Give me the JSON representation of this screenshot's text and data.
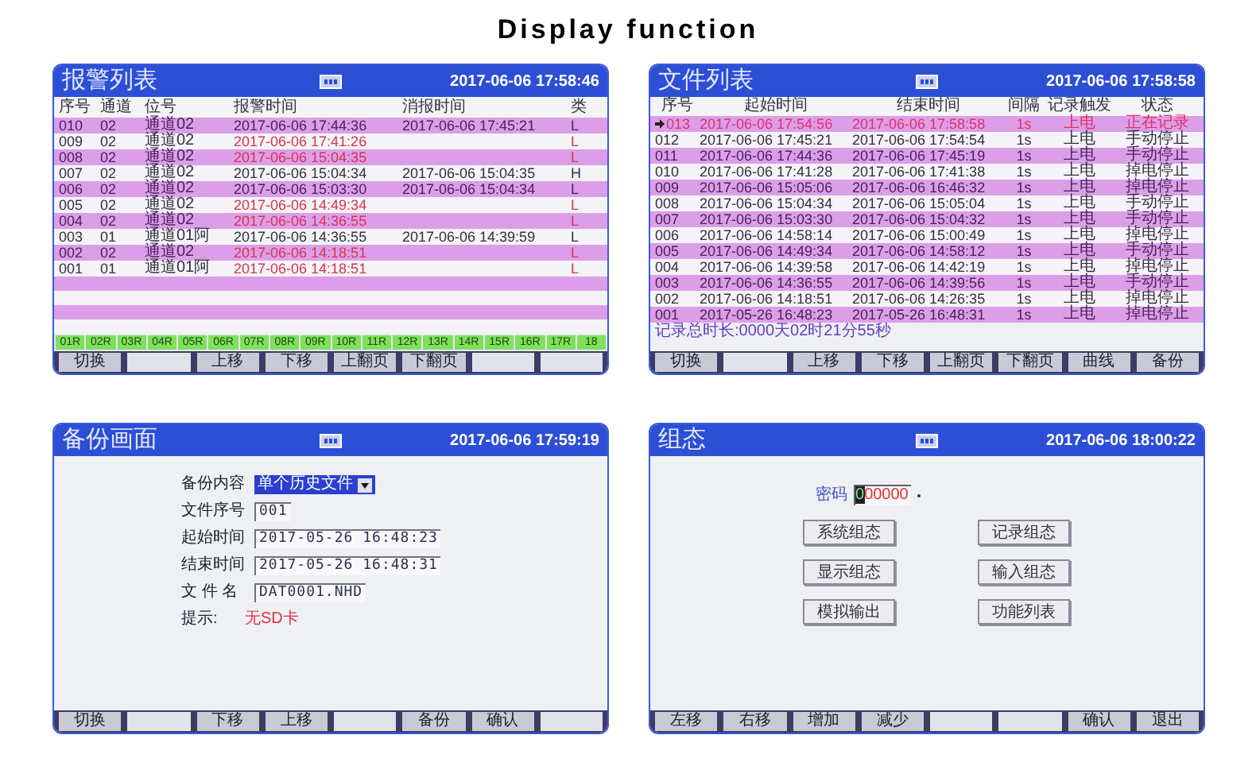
{
  "page_title": "Display function",
  "alarm_list": {
    "title": "报警列表",
    "datetime": "2017-06-06 17:58:46",
    "columns": [
      "序号",
      "通道",
      "位号",
      "报警时间",
      "消报时间",
      "类"
    ],
    "rows": [
      {
        "no": "010",
        "channel": "02",
        "tag": "通道02",
        "alarm_time": "2017-06-06 17:44:36",
        "clear_time": "2017-06-06 17:45:21",
        "type": "L",
        "cleared": true
      },
      {
        "no": "009",
        "channel": "02",
        "tag": "通道02",
        "alarm_time": "2017-06-06 17:41:26",
        "type": "L",
        "cleared": false
      },
      {
        "no": "008",
        "channel": "02",
        "tag": "通道02",
        "alarm_time": "2017-06-06 15:04:35",
        "type": "L",
        "cleared": false
      },
      {
        "no": "007",
        "channel": "02",
        "tag": "通道02",
        "alarm_time": "2017-06-06 15:04:34",
        "clear_time": "2017-06-06 15:04:35",
        "type": "H",
        "cleared": true
      },
      {
        "no": "006",
        "channel": "02",
        "tag": "通道02",
        "alarm_time": "2017-06-06 15:03:30",
        "clear_time": "2017-06-06 15:04:34",
        "type": "L",
        "cleared": true
      },
      {
        "no": "005",
        "channel": "02",
        "tag": "通道02",
        "alarm_time": "2017-06-06 14:49:34",
        "type": "L",
        "cleared": false
      },
      {
        "no": "004",
        "channel": "02",
        "tag": "通道02",
        "alarm_time": "2017-06-06 14:36:55",
        "type": "L",
        "cleared": false
      },
      {
        "no": "003",
        "channel": "01",
        "tag": "通道01阿",
        "alarm_time": "2017-06-06 14:36:55",
        "clear_time": "2017-06-06 14:39:59",
        "type": "L",
        "cleared": true
      },
      {
        "no": "002",
        "channel": "02",
        "tag": "通道02",
        "alarm_time": "2017-06-06 14:18:51",
        "type": "L",
        "cleared": false
      },
      {
        "no": "001",
        "channel": "01",
        "tag": "通道01阿",
        "alarm_time": "2017-06-06 14:18:51",
        "type": "L",
        "cleared": false
      }
    ],
    "channels": [
      "01R",
      "02R",
      "03R",
      "04R",
      "05R",
      "06R",
      "07R",
      "08R",
      "09R",
      "10R",
      "11R",
      "12R",
      "13R",
      "14R",
      "15R",
      "16R",
      "17R",
      "18"
    ],
    "buttons": [
      {
        "kind": "label",
        "label": "切换"
      },
      {
        "kind": "blank"
      },
      {
        "kind": "label",
        "label": "上移"
      },
      {
        "kind": "label",
        "label": "下移"
      },
      {
        "kind": "label",
        "label": "上翻页"
      },
      {
        "kind": "label",
        "label": "下翻页"
      },
      {
        "kind": "blank"
      },
      {
        "kind": "blank"
      }
    ]
  },
  "file_list": {
    "title": "文件列表",
    "datetime": "2017-06-06 17:58:58",
    "columns": [
      "序号",
      "起始时间",
      "结束时间",
      "间隔",
      "记录触发",
      "状态"
    ],
    "rows": [
      {
        "no": "013",
        "start": "2017-06-06 17:54:56",
        "end": "2017-06-06 17:58:58",
        "interval": "1s",
        "trigger": "上电",
        "status": "正在记录",
        "recording": true
      },
      {
        "no": "012",
        "start": "2017-06-06 17:45:21",
        "end": "2017-06-06 17:54:54",
        "interval": "1s",
        "trigger": "上电",
        "status": "手动停止",
        "recording": false
      },
      {
        "no": "011",
        "start": "2017-06-06 17:44:36",
        "end": "2017-06-06 17:45:19",
        "interval": "1s",
        "trigger": "上电",
        "status": "手动停止",
        "recording": false
      },
      {
        "no": "010",
        "start": "2017-06-06 17:41:28",
        "end": "2017-06-06 17:41:38",
        "interval": "1s",
        "trigger": "上电",
        "status": "掉电停止",
        "recording": false
      },
      {
        "no": "009",
        "start": "2017-06-06 15:05:06",
        "end": "2017-06-06 16:46:32",
        "interval": "1s",
        "trigger": "上电",
        "status": "掉电停止",
        "recording": false
      },
      {
        "no": "008",
        "start": "2017-06-06 15:04:34",
        "end": "2017-06-06 15:05:04",
        "interval": "1s",
        "trigger": "上电",
        "status": "手动停止",
        "recording": false
      },
      {
        "no": "007",
        "start": "2017-06-06 15:03:30",
        "end": "2017-06-06 15:04:32",
        "interval": "1s",
        "trigger": "上电",
        "status": "手动停止",
        "recording": false
      },
      {
        "no": "006",
        "start": "2017-06-06 14:58:14",
        "end": "2017-06-06 15:00:49",
        "interval": "1s",
        "trigger": "上电",
        "status": "掉电停止",
        "recording": false
      },
      {
        "no": "005",
        "start": "2017-06-06 14:49:34",
        "end": "2017-06-06 14:58:12",
        "interval": "1s",
        "trigger": "上电",
        "status": "手动停止",
        "recording": false
      },
      {
        "no": "004",
        "start": "2017-06-06 14:39:58",
        "end": "2017-06-06 14:42:19",
        "interval": "1s",
        "trigger": "上电",
        "status": "掉电停止",
        "recording": false
      },
      {
        "no": "003",
        "start": "2017-06-06 14:36:55",
        "end": "2017-06-06 14:39:56",
        "interval": "1s",
        "trigger": "上电",
        "status": "手动停止",
        "recording": false
      },
      {
        "no": "002",
        "start": "2017-06-06 14:18:51",
        "end": "2017-06-06 14:26:35",
        "interval": "1s",
        "trigger": "上电",
        "status": "掉电停止",
        "recording": false
      },
      {
        "no": "001",
        "start": "2017-05-26 16:48:23",
        "end": "2017-05-26 16:48:31",
        "interval": "1s",
        "trigger": "上电",
        "status": "掉电停止",
        "recording": false
      }
    ],
    "total": "记录总时长:0000天02时21分55秒",
    "buttons": [
      {
        "kind": "label",
        "label": "切换"
      },
      {
        "kind": "blank"
      },
      {
        "kind": "label",
        "label": "上移"
      },
      {
        "kind": "label",
        "label": "下移"
      },
      {
        "kind": "label",
        "label": "上翻页"
      },
      {
        "kind": "label",
        "label": "下翻页"
      },
      {
        "kind": "label",
        "label": "曲线"
      },
      {
        "kind": "label",
        "label": "备份"
      }
    ]
  },
  "backup": {
    "title": "备份画面",
    "datetime": "2017-06-06 17:59:19",
    "fields": [
      {
        "kind": "select",
        "label": "备份内容",
        "value": "单个历史文件"
      },
      {
        "kind": "text",
        "label": "文件序号",
        "value": "001"
      },
      {
        "kind": "text",
        "label": "起始时间",
        "value": "2017-05-26 16:48:23"
      },
      {
        "kind": "text",
        "label": "结束时间",
        "value": "2017-05-26 16:48:31"
      },
      {
        "kind": "text",
        "label": "文 件 名",
        "value": "DAT0001.NHD"
      }
    ],
    "hint_label": "提示:",
    "hint": "无SD卡",
    "buttons": [
      {
        "kind": "label",
        "label": "切换"
      },
      {
        "kind": "blank"
      },
      {
        "kind": "label",
        "label": "下移"
      },
      {
        "kind": "label",
        "label": "上移"
      },
      {
        "kind": "blank"
      },
      {
        "kind": "label",
        "label": "备份"
      },
      {
        "kind": "label",
        "label": "确认"
      },
      {
        "kind": "blank"
      }
    ]
  },
  "config": {
    "title": "组态",
    "datetime": "2017-06-06 18:00:22",
    "password_label": "密码",
    "password": "000000",
    "menu": [
      "系统组态",
      "记录组态",
      "显示组态",
      "输入组态",
      "模拟输出",
      "功能列表"
    ],
    "buttons": [
      {
        "kind": "label",
        "label": "左移"
      },
      {
        "kind": "label",
        "label": "右移"
      },
      {
        "kind": "label",
        "label": "增加"
      },
      {
        "kind": "label",
        "label": "减少"
      },
      {
        "kind": "blank"
      },
      {
        "kind": "blank"
      },
      {
        "kind": "label",
        "label": "确认"
      },
      {
        "kind": "label",
        "label": "退出"
      }
    ]
  }
}
